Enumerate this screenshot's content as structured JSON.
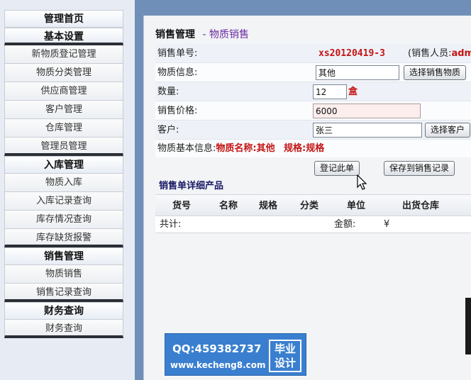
{
  "sidebar": {
    "groups": [
      {
        "head": "管理首页",
        "items": []
      },
      {
        "head": "基本设置",
        "items": [
          "新物质登记管理",
          "物质分类管理",
          "供应商管理",
          "客户管理",
          "仓库管理",
          "管理员管理"
        ]
      },
      {
        "head": "入库管理",
        "items": [
          "物质入库",
          "入库记录查询",
          "库存情况查询",
          "库存缺货报警"
        ]
      },
      {
        "head": "销售管理",
        "items": [
          "物质销售",
          "销售记录查询"
        ]
      },
      {
        "head": "财务查询",
        "items": [
          "财务查询"
        ]
      }
    ]
  },
  "main": {
    "title": "销售管理",
    "title_sep": "-",
    "subtitle": "物质销售",
    "order_label": "销售单号:",
    "order_no": "xs20120419-3",
    "seller_prefix": "(销售人员:",
    "seller_name": "adm",
    "goods_label": "物质信息:",
    "goods_value": "其他",
    "select_goods_button": "选择销售物质",
    "qty_label": "数量:",
    "qty_value": "12",
    "qty_unit": "盒",
    "price_label": "销售价格:",
    "price_value": "6000",
    "customer_label": "客户:",
    "customer_value": "张三",
    "select_customer_button": "选择客户",
    "info_label": "物质基本信息:",
    "info_name_label": "物质名称:",
    "info_name_value": "其他",
    "info_spec_label": "规格:",
    "info_spec_value": "规格",
    "register_button": "登记此单",
    "save_button": "保存到销售记录",
    "detail_title": "销售单详细产品",
    "columns": [
      "货号",
      "名称",
      "规格",
      "分类",
      "单位",
      "出货仓库"
    ],
    "total_label": "共计:",
    "amount_label": "金额:",
    "currency": "¥"
  },
  "watermark": {
    "qq": "QQ:459382737",
    "site": "www.kecheng8.com",
    "badge_line1": "毕业",
    "badge_line2": "设计"
  }
}
